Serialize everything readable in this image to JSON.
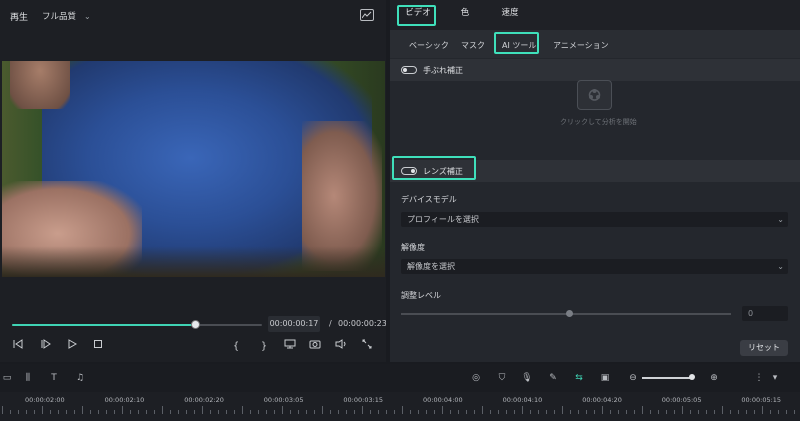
{
  "preview": {
    "play_label": "再生",
    "quality": "フル品質",
    "timecode_current": "00:00:00:17",
    "timecode_separator": "/",
    "timecode_total": "00:00:00:23",
    "progress": 0.73
  },
  "inspector": {
    "tabs": [
      "ビデオ",
      "色",
      "速度"
    ],
    "active_tab": "ビデオ",
    "subtabs": [
      "ベーシック",
      "マスク",
      "AI ツール",
      "アニメーション"
    ],
    "active_subtab": "AI ツール",
    "stabilize": {
      "label": "手ぶれ補正",
      "enabled": false,
      "placeholder_text": "クリックして分析を開始"
    },
    "lens": {
      "label": "レンズ補正",
      "enabled": true
    },
    "device_model": {
      "label": "デバイスモデル",
      "value": "プロフィールを選択"
    },
    "resolution": {
      "label": "解像度",
      "value": "解像度を選択"
    },
    "adjust_level": {
      "label": "調整レベル",
      "value": "0",
      "level": 0.5
    },
    "reset_label": "リセット",
    "highlight_color": "#3fe0bb"
  },
  "timeline": {
    "ruler": [
      "00:00:02:00",
      "00:00:02:10",
      "00:00:02:20",
      "00:00:03:05",
      "00:00:03:15",
      "00:00:04:00",
      "00:00:04:10",
      "00:00:04:20",
      "00:00:05:05",
      "00:00:05:15"
    ],
    "zoom": 0.95
  },
  "colors": {
    "accent": "#3fd3b4",
    "panel": "#24272d",
    "bg": "#191b20"
  }
}
